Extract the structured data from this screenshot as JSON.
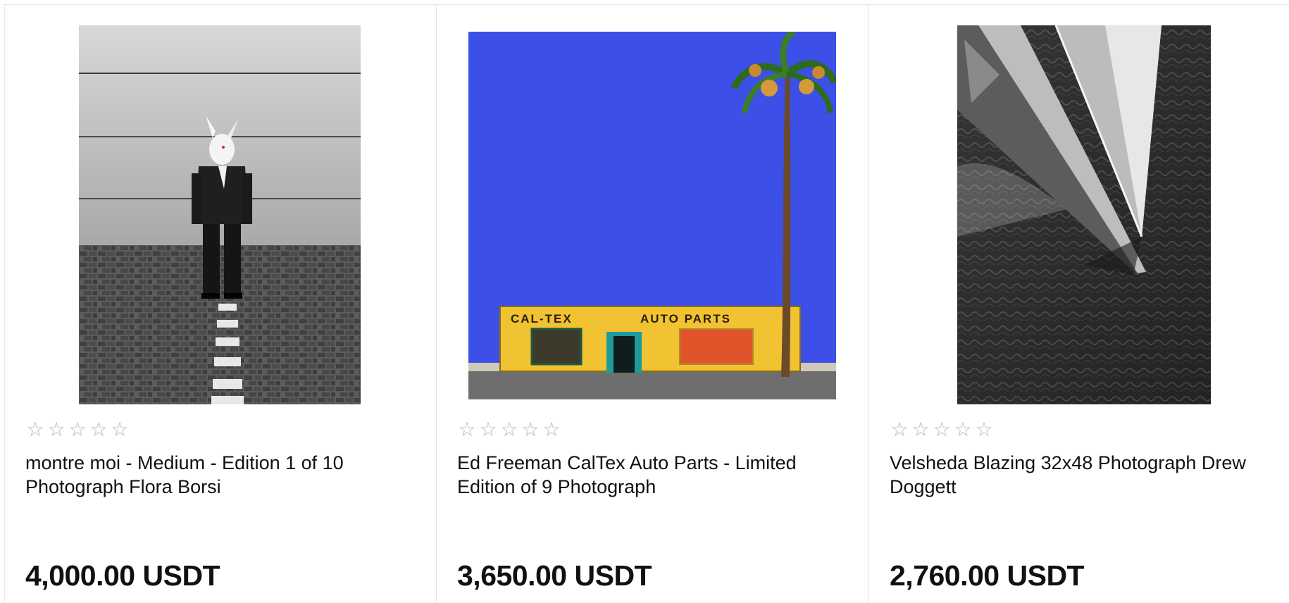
{
  "products": [
    {
      "title": "montre moi - Medium - Edition 1 of 10 Photograph Flora Borsi",
      "price": "4,000.00 USDT",
      "rating": 0,
      "rating_max": 5,
      "image_icon": "rabbit-man-photo-icon"
    },
    {
      "title": "Ed Freeman CalTex Auto Parts - Limited Edition of 9 Photograph",
      "price": "3,650.00 USDT",
      "rating": 0,
      "rating_max": 5,
      "image_icon": "caltex-storefront-photo-icon",
      "sign_left": "CAL-TEX",
      "sign_right": "AUTO PARTS"
    },
    {
      "title": "Velsheda Blazing 32x48 Photograph Drew Doggett",
      "price": "2,760.00 USDT",
      "rating": 0,
      "rating_max": 5,
      "image_icon": "sailboat-aerial-photo-icon"
    }
  ],
  "colors": {
    "star_empty": "#b5b5b5",
    "sky_blue": "#3c4fe6",
    "building_yellow": "#f1c232",
    "door_teal": "#1e9a9a",
    "window_orange": "#e0532b"
  }
}
